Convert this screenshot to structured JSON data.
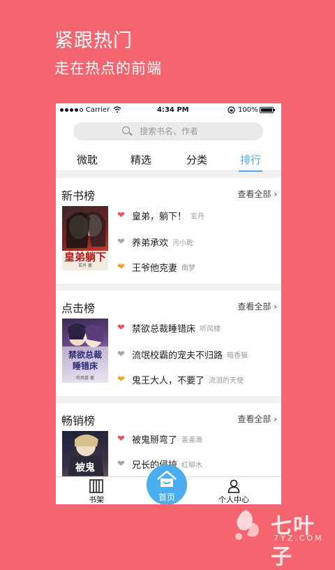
{
  "promo": {
    "title": "紧跟热门",
    "subtitle": "走在热点的前端"
  },
  "statusbar": {
    "carrier": "Carrier",
    "time": "4:34 PM",
    "battery": "100%"
  },
  "search": {
    "placeholder": "搜索书名、作者"
  },
  "tabs": [
    {
      "label": "微耽",
      "active": false
    },
    {
      "label": "精选",
      "active": false
    },
    {
      "label": "分类",
      "active": false
    },
    {
      "label": "排行",
      "active": true
    }
  ],
  "sections": [
    {
      "title": "新书榜",
      "more": "查看全部 ›",
      "cover": {
        "title": "皇弟躺下",
        "author": "玄丹 著"
      },
      "items": [
        {
          "rank_icon": "red-heart-icon",
          "name": "皇弟，躺下！",
          "author": "玄丹"
        },
        {
          "rank_icon": "gray-heart-icon",
          "name": "养弟承欢",
          "author": "污小乾"
        },
        {
          "rank_icon": "orange-heart-icon",
          "name": "王爷他克妻",
          "author": "南梦"
        }
      ]
    },
    {
      "title": "点击榜",
      "more": "查看全部 ›",
      "cover": {
        "title": "禁欲总裁 睡错床",
        "author": "听风楼 著"
      },
      "items": [
        {
          "rank_icon": "red-heart-icon",
          "name": "禁欲总裁睡错床",
          "author": "听风楼"
        },
        {
          "rank_icon": "gray-heart-icon",
          "name": "流氓校霸的宠夫不归路",
          "author": "暗香猫"
        },
        {
          "rank_icon": "orange-heart-icon",
          "name": "鬼王大人，不要了",
          "author": "流泪的天使"
        }
      ]
    },
    {
      "title": "畅销榜",
      "more": "查看全部 ›",
      "cover": {
        "title": "被鬼",
        "author": ""
      },
      "items": [
        {
          "rank_icon": "red-heart-icon",
          "name": "被鬼掰弯了",
          "author": "盖盖渔"
        },
        {
          "rank_icon": "gray-heart-icon",
          "name": "兄长的侵掠",
          "author": "红柳木"
        }
      ]
    }
  ],
  "bottom_nav": {
    "bookshelf": "书架",
    "home": "首页",
    "profile": "个人中心"
  },
  "watermark": {
    "text": "七叶子",
    "url": "7YZ.COM"
  },
  "colors": {
    "background": "#f4656f",
    "accent": "#4aa7f0",
    "heart_red": "#f0505c",
    "heart_gray": "#a6a6a6",
    "heart_orange": "#f5a623"
  }
}
